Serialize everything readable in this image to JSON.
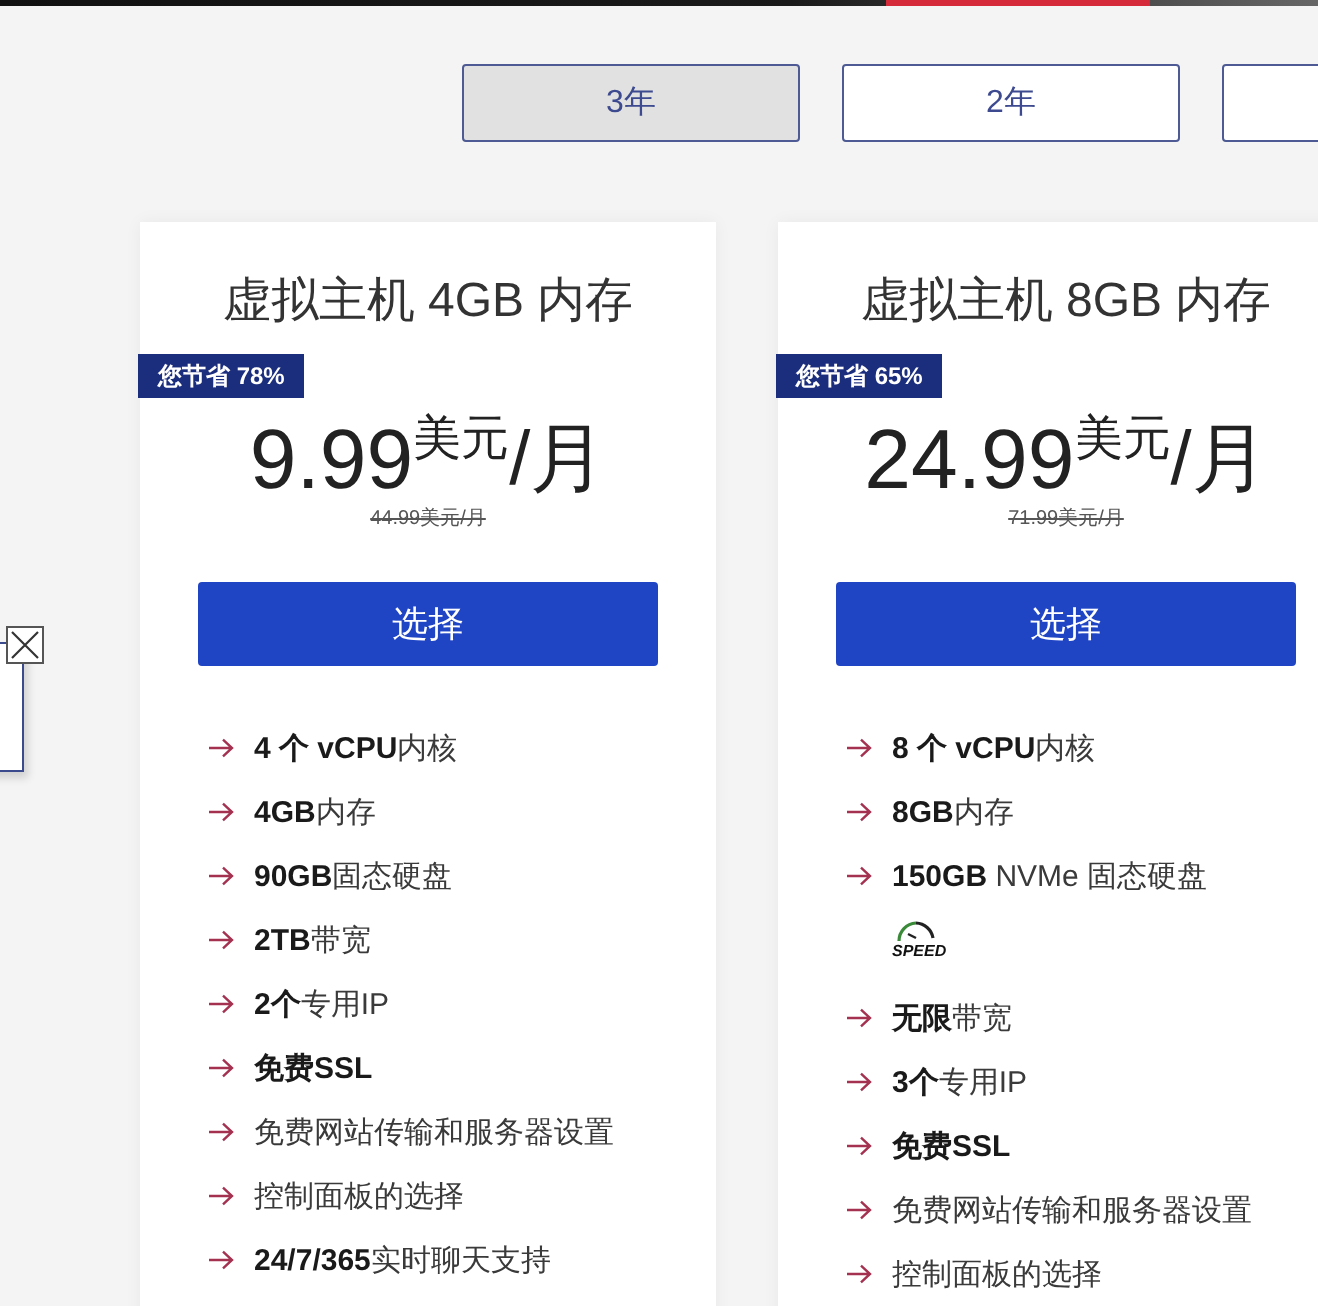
{
  "billing_tabs": [
    {
      "label": "3年",
      "selected": true
    },
    {
      "label": "2年",
      "selected": false
    },
    {
      "selected": false
    }
  ],
  "plans": [
    {
      "title": "虚拟主机 4GB 内存",
      "savings": "您节省 78%",
      "price": {
        "amount": "9.99",
        "currency": "美元",
        "period": "/月"
      },
      "old_price": "44.99美元/月",
      "button": "选择",
      "features": [
        {
          "text": "**4 个 vCPU**内核",
          "bold": false
        },
        {
          "text": "**4GB**内存",
          "bold": false
        },
        {
          "text": "**90GB**固态硬盘",
          "bold": false
        },
        {
          "text": "**2TB**带宽",
          "bold": false
        },
        {
          "text": "**2个**专用IP",
          "bold": false
        },
        {
          "text": "免费SSL",
          "bold": true
        },
        {
          "text": "免费网站传输和服务器设置",
          "bold": false
        },
        {
          "text": "控制面板的选择",
          "bold": false
        },
        {
          "text": "**24/7/365**实时聊天支持",
          "bold": false
        }
      ]
    },
    {
      "title": "虚拟主机 8GB 内存",
      "savings": "您节省 65%",
      "price": {
        "amount": "24.99",
        "currency": "美元",
        "period": "/月"
      },
      "old_price": "71.99美元/月",
      "button": "选择",
      "features": [
        {
          "text": "**8 个 vCPU**内核",
          "bold": false
        },
        {
          "text": "**8GB**内存",
          "bold": false
        },
        {
          "text": "**150GB** NVMe 固态硬盘",
          "bold": false,
          "badge": "SPEED"
        },
        {
          "text": "**无限**带宽",
          "bold": false
        },
        {
          "text": "**3个**专用IP",
          "bold": false
        },
        {
          "text": "免费SSL",
          "bold": true
        },
        {
          "text": "免费网站传输和服务器设置",
          "bold": false
        },
        {
          "text": "控制面板的选择",
          "bold": false
        }
      ]
    }
  ]
}
